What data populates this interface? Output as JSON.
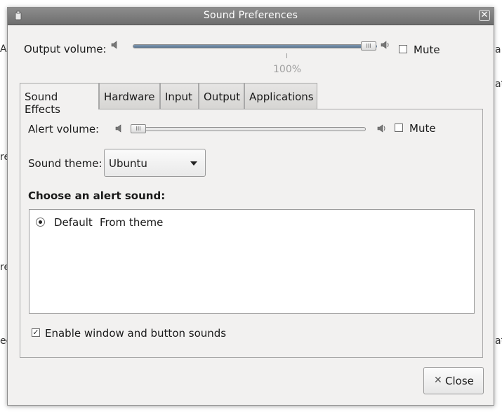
{
  "window": {
    "title": "Sound Preferences",
    "close_glyph": "✕"
  },
  "background_fragments": {
    "left_1": "Ad",
    "left_2": "re",
    "left_3": "re",
    "left_4": "ec",
    "right_1": "a",
    "right_2": "at",
    "right_3": "att"
  },
  "output": {
    "label": "Output volume:",
    "level_percent": 100,
    "level_label": "100%",
    "mute_label": "Mute",
    "mute_checked": false
  },
  "tabs": [
    {
      "label": "Sound Effects",
      "active": true
    },
    {
      "label": "Hardware",
      "active": false
    },
    {
      "label": "Input",
      "active": false
    },
    {
      "label": "Output",
      "active": false
    },
    {
      "label": "Applications",
      "active": false
    }
  ],
  "sound_effects": {
    "alert_volume_label": "Alert volume:",
    "alert_level_percent": 0,
    "mute_label": "Mute",
    "mute_checked": false,
    "theme_label": "Sound theme:",
    "theme_value": "Ubuntu",
    "choose_heading": "Choose an alert sound:",
    "alerts": [
      {
        "name": "Default",
        "type": "From theme",
        "selected": true
      }
    ],
    "enable_sounds_label": "Enable window and button sounds",
    "enable_sounds_checked": true
  },
  "buttons": {
    "close_label": "Close",
    "close_icon": "✕"
  },
  "icons": {
    "speaker_low": "speaker-low-icon",
    "speaker_high": "speaker-high-icon",
    "app": "app-icon"
  }
}
